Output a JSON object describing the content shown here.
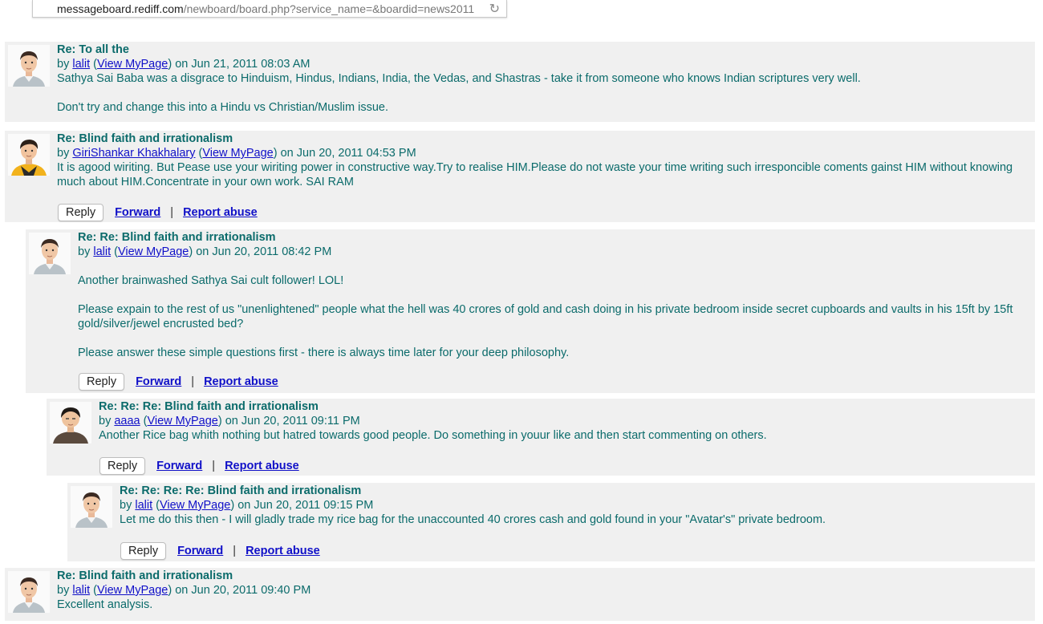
{
  "browser": {
    "url_domain": "messageboard.rediff.com",
    "url_rest": "/newboard/board.php?service_name=&boardid=news2011",
    "reload_icon": "reload-icon"
  },
  "ui": {
    "reply_label": "Reply",
    "forward_label": "Forward",
    "report_label": "Report abuse",
    "separator": "|",
    "by_prefix": "by",
    "view_mypage": "View MyPage",
    "on_word": "on"
  },
  "posts": [
    {
      "title": "Re: To all the",
      "author": "lalit",
      "date": "Jun 21, 2011 08:03 AM",
      "paragraphs": [
        "Sathya Sai Baba was a disgrace to Hinduism, Hindus, Indians, India, the Vedas, and Shastras - take it from someone who knows Indian scriptures very well.",
        "Don't try and change this into a Hindu vs Christian/Muslim issue."
      ],
      "avatar": "man-avatar-icon"
    },
    {
      "title": "Re: Blind faith and irrationalism",
      "author": "GiriShankar Khakhalary",
      "date": "Jun 20, 2011 04:53 PM",
      "paragraphs": [
        "It is agood wiriting. But Pease use your wiriting power in constructive way.Try to realise HIM.Please do not waste your time writing such irresponcible coments gainst HIM without knowing much about HIM.Concentrate in your own work. SAI RAM"
      ],
      "avatar": "young-man-avatar-icon"
    },
    {
      "title": "Re: Re: Blind faith and irrationalism",
      "author": "lalit",
      "date": "Jun 20, 2011 08:42 PM",
      "paragraphs": [
        "Another brainwashed Sathya Sai cult follower! LOL!",
        "Please expain to the rest of us \"unenlightened\" people what the hell was 40 crores of gold and cash doing in his private bedroom inside secret cupboards and vaults in his 15ft by 15ft gold/silver/jewel encrusted bed?",
        "Please answer these simple questions first - there is always time later for your deep philosophy."
      ],
      "avatar": "man-avatar-icon"
    },
    {
      "title": "Re: Re: Re: Blind faith and irrationalism",
      "author": "aaaa",
      "date": "Jun 20, 2011 09:11 PM",
      "paragraphs": [
        "Another Rice bag whith nothing but hatred towards good people. Do something in youur like and then start commenting on others."
      ],
      "avatar": "asian-man-avatar-icon"
    },
    {
      "title": "Re: Re: Re: Re: Blind faith and irrationalism",
      "author": "lalit",
      "date": "Jun 20, 2011 09:15 PM",
      "paragraphs": [
        "Let me do this then - I will gladly trade my rice bag for the unaccounted 40 crores cash and gold found in your \"Avatar's\" private bedroom."
      ],
      "avatar": "man-avatar-icon"
    },
    {
      "title": "Re: Blind faith and irrationalism",
      "author": "lalit",
      "date": "Jun 20, 2011 09:40 PM",
      "paragraphs": [
        "Excellent analysis."
      ],
      "avatar": "man-avatar-icon"
    }
  ],
  "colors": {
    "text_teal": "#0b6b6b",
    "link_blue": "#1010c8",
    "post_bg": "#f0f0f0"
  }
}
